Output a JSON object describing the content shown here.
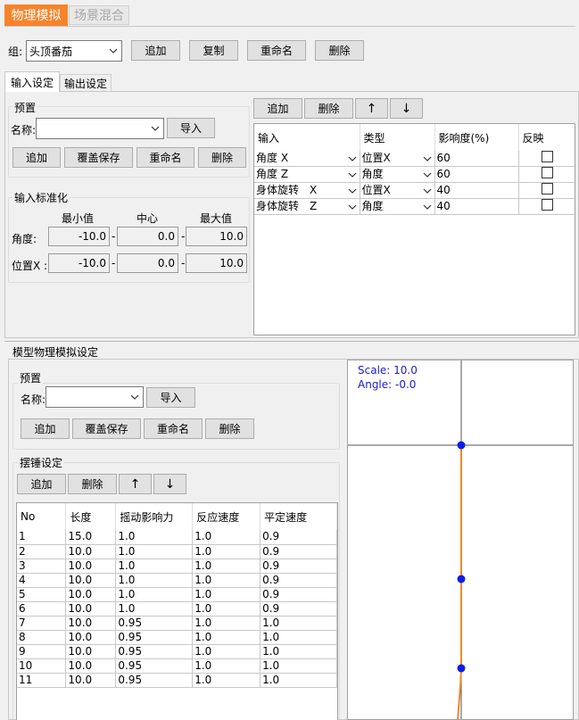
{
  "top_tabs": [
    {
      "label": "物理模拟",
      "active": true
    },
    {
      "label": "场景混合",
      "active": false
    }
  ],
  "group_row": {
    "label": "组:",
    "value": "头顶番茄",
    "buttons": [
      "追加",
      "复制",
      "重命名",
      "删除"
    ]
  },
  "sub_tabs": [
    {
      "label": "输入设定",
      "active": true
    },
    {
      "label": "输出设定",
      "active": false
    }
  ],
  "preset": {
    "title": "预置",
    "name_label": "名称:",
    "import_label": "导入",
    "buttons": [
      "追加",
      "覆盖保存",
      "重命名",
      "删除"
    ]
  },
  "normalize": {
    "title": "输入标准化",
    "headers": [
      "最小值",
      "中心",
      "最大值"
    ],
    "rows": [
      {
        "label": "角度:",
        "min": "-10.0",
        "center": "0.0",
        "max": "10.0"
      },
      {
        "label": "位置X :",
        "min": "-10.0",
        "center": "0.0",
        "max": "10.0"
      }
    ],
    "separator": "-"
  },
  "input_toolbar": {
    "add": "追加",
    "delete": "删除",
    "up": "↑",
    "down": "↓"
  },
  "input_table": {
    "headers": [
      "输入",
      "类型",
      "影响度(%)",
      "反映"
    ],
    "rows": [
      {
        "input": "角度 X",
        "type": "位置X",
        "weight": "60"
      },
      {
        "input": "角度 Z",
        "type": "角度",
        "weight": "60"
      },
      {
        "input": "身体旋转　X",
        "type": "位置X",
        "weight": "40"
      },
      {
        "input": "身体旋转　Z",
        "type": "角度",
        "weight": "40"
      }
    ]
  },
  "model_section": {
    "title": "模型物理模拟设定"
  },
  "model_preset": {
    "title": "预置",
    "name_label": "名称:",
    "import_label": "导入",
    "buttons": [
      "追加",
      "覆盖保存",
      "重命名",
      "删除"
    ]
  },
  "pendulum": {
    "title": "摆锤设定",
    "add": "追加",
    "delete": "删除",
    "up": "↑",
    "down": "↓"
  },
  "pendulum_table": {
    "headers": [
      "No",
      "长度",
      "摇动影响力",
      "反应速度",
      "平定速度"
    ],
    "rows": [
      [
        "1",
        "15.0",
        "1.0",
        "1.0",
        "0.9"
      ],
      [
        "2",
        "10.0",
        "1.0",
        "1.0",
        "0.9"
      ],
      [
        "3",
        "10.0",
        "1.0",
        "1.0",
        "0.9"
      ],
      [
        "4",
        "10.0",
        "1.0",
        "1.0",
        "0.9"
      ],
      [
        "5",
        "10.0",
        "1.0",
        "1.0",
        "0.9"
      ],
      [
        "6",
        "10.0",
        "1.0",
        "1.0",
        "0.9"
      ],
      [
        "7",
        "10.0",
        "0.95",
        "1.0",
        "1.0"
      ],
      [
        "8",
        "10.0",
        "0.95",
        "1.0",
        "1.0"
      ],
      [
        "9",
        "10.0",
        "0.95",
        "1.0",
        "1.0"
      ],
      [
        "10",
        "10.0",
        "0.95",
        "1.0",
        "1.0"
      ],
      [
        "11",
        "10.0",
        "0.95",
        "1.0",
        "1.0"
      ]
    ]
  },
  "preview": {
    "scale": "Scale: 10.0",
    "angle": "Angle: -0.0",
    "colors": {
      "text": "#1a1acc",
      "line": "#f08a28",
      "joint": "#0a1ee6",
      "axis": "#555555"
    }
  },
  "colors": {
    "active_tab": "#f7832b",
    "inactive_tab_text": "#a8a8a8"
  }
}
